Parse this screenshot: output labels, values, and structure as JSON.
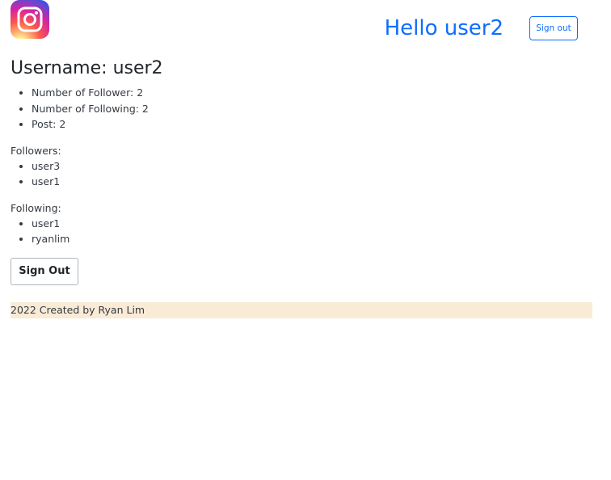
{
  "header": {
    "logo_icon": "instagram-logo-icon",
    "greeting": "Hello user2",
    "signout_label": "Sign out",
    "accent_color": "#0d6efd"
  },
  "profile": {
    "username_label": "Username:",
    "username_value": "user2",
    "stats": [
      "Number of Follower: 2",
      "Number of Following: 2",
      "Post: 2"
    ]
  },
  "followers": {
    "label": "Followers:",
    "items": [
      "user3",
      "user1"
    ]
  },
  "following": {
    "label": "Following:",
    "items": [
      "user1",
      "ryanlim"
    ]
  },
  "actions": {
    "signout_label": "Sign Out"
  },
  "footer": {
    "text": "2022 Created by Ryan Lim",
    "background_color": "#faebd7"
  }
}
